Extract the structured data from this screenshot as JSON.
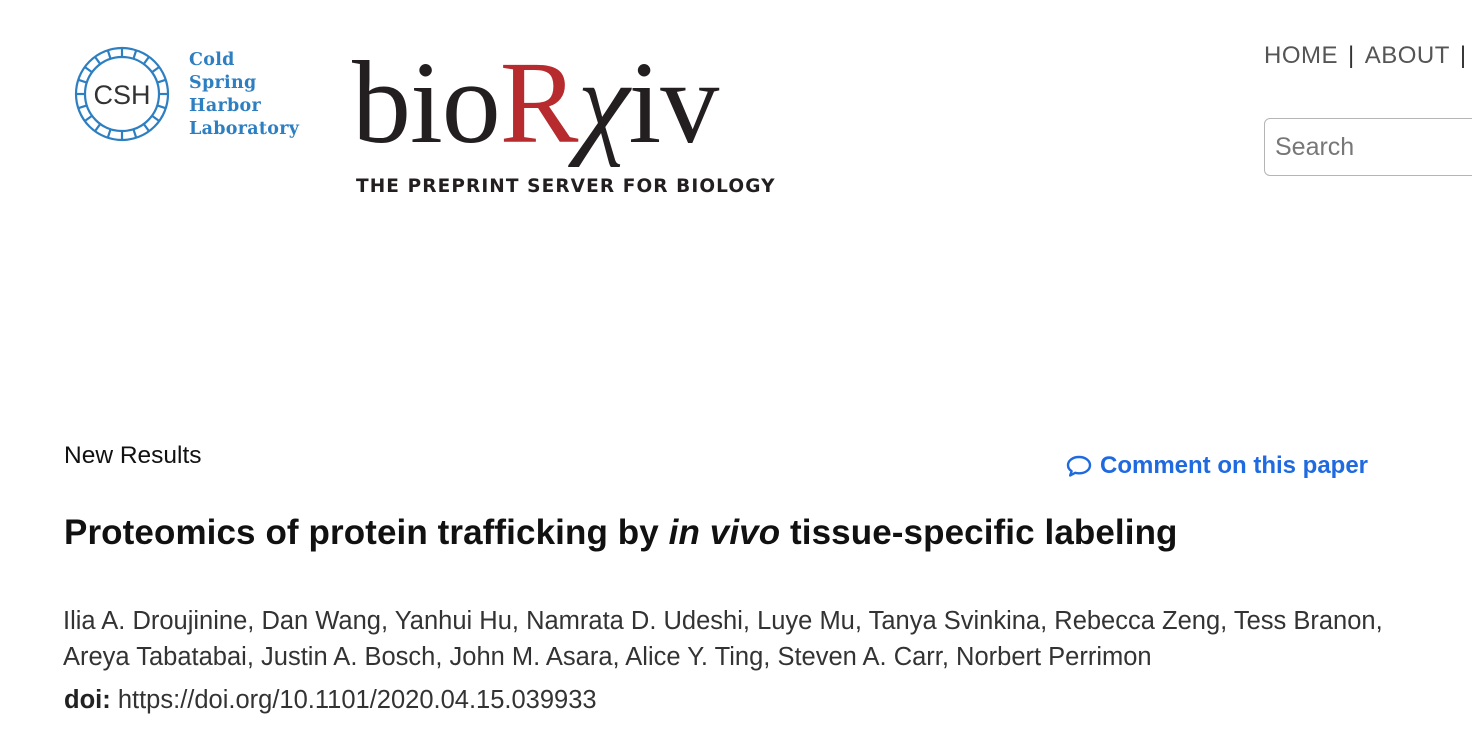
{
  "cshl_logo": {
    "emblem_text": "CSH",
    "text_lines": [
      "Cold",
      "Spring",
      "Harbor",
      "Laboratory"
    ]
  },
  "biorxiv_logo": {
    "wordmark_bio": "bio",
    "wordmark_r": "R",
    "wordmark_chi": "χ",
    "wordmark_iv": "iv",
    "tagline": "THE PREPRINT SERVER FOR BIOLOGY"
  },
  "nav": {
    "home": "HOME",
    "about": "ABOUT",
    "separator": "|"
  },
  "search": {
    "placeholder": "Search"
  },
  "article": {
    "type": "New Results",
    "comment_link": "Comment on this paper",
    "title_before": "Proteomics of protein trafficking by ",
    "title_italic": "in vivo",
    "title_after": " tissue-specific labeling",
    "authors": [
      "Ilia A. Droujinine",
      "Dan Wang",
      "Yanhui Hu",
      "Namrata D. Udeshi",
      "Luye Mu",
      "Tanya Svinkina",
      "Rebecca Zeng",
      "Tess Branon",
      "Areya Tabatabai",
      "Justin A. Bosch",
      "John M. Asara",
      "Alice Y. Ting",
      "Steven A. Carr",
      "Norbert Perrimon"
    ],
    "doi_label": "doi:",
    "doi": "https://doi.org/10.1101/2020.04.15.039933"
  },
  "colors": {
    "cshl_blue": "#2d7fc1",
    "biorxiv_red": "#b72b2f",
    "link_blue": "#1f6ae0",
    "text_dark": "#111111"
  }
}
